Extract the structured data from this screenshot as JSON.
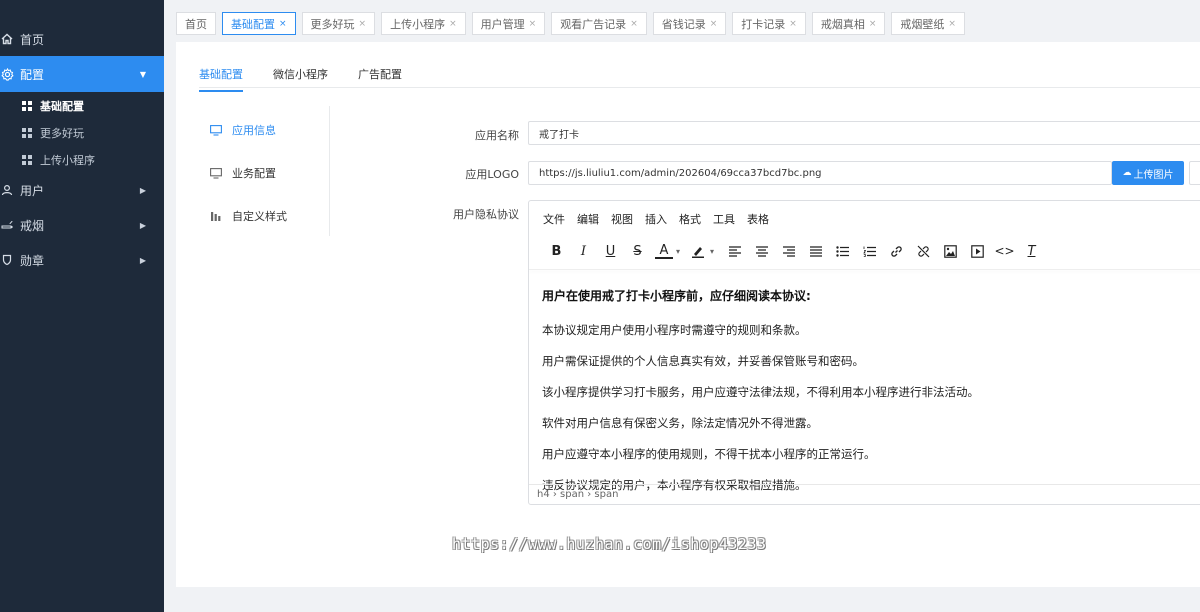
{
  "sidebar": {
    "brand": "",
    "menu": [
      {
        "label": "首页",
        "icon": "home-icon"
      },
      {
        "label": "配置",
        "icon": "gear-icon"
      },
      {
        "label": "用户",
        "icon": "user-icon"
      },
      {
        "label": "戒烟",
        "icon": "smoke-icon"
      },
      {
        "label": "勋章",
        "icon": "medal-icon"
      }
    ],
    "submenu": [
      {
        "label": "基础配置"
      },
      {
        "label": "更多好玩"
      },
      {
        "label": "上传小程序"
      }
    ]
  },
  "tabs": [
    {
      "label": "首页"
    },
    {
      "label": "基础配置"
    },
    {
      "label": "更多好玩"
    },
    {
      "label": "上传小程序"
    },
    {
      "label": "用户管理"
    },
    {
      "label": "观看广告记录"
    },
    {
      "label": "省钱记录"
    },
    {
      "label": "打卡记录"
    },
    {
      "label": "戒烟真相"
    },
    {
      "label": "戒烟壁纸"
    }
  ],
  "tab_close": "×",
  "inner_tabs": [
    {
      "label": "基础配置"
    },
    {
      "label": "微信小程序"
    },
    {
      "label": "广告配置"
    }
  ],
  "side_menu": [
    {
      "label": "应用信息",
      "icon": "monitor-icon"
    },
    {
      "label": "业务配置",
      "icon": "monitor-icon"
    },
    {
      "label": "自定义样式",
      "icon": "bar-chart-icon"
    }
  ],
  "form": {
    "app_name_label": "应用名称",
    "app_name_value": "戒了打卡",
    "app_logo_label": "应用LOGO",
    "app_logo_value": "https://js.liuliu1.com/admin/202604/69cca37bcd7bc.png",
    "upload_label": "上传图片",
    "privacy_label": "用户隐私协议"
  },
  "editor": {
    "menubar": [
      "文件",
      "编辑",
      "视图",
      "插入",
      "格式",
      "工具",
      "表格"
    ],
    "heading": "用户在使用戒了打卡小程序前，应仔细阅读本协议:",
    "paragraphs": [
      "本协议规定用户使用小程序时需遵守的规则和条款。",
      "用户需保证提供的个人信息真实有效，并妥善保管账号和密码。",
      "该小程序提供学习打卡服务，用户应遵守法律法规，不得利用本小程序进行非法活动。",
      "软件对用户信息有保密义务，除法定情况外不得泄露。",
      "用户应遵守本小程序的使用规则，不得干扰本小程序的正常运行。",
      "违反协议规定的用户，本小程序有权采取相应措施。"
    ],
    "status_path": "h4 › span › span"
  },
  "watermark": "https://www.huzhan.com/ishop43233",
  "colors": {
    "accent": "#2d8cf0",
    "sidebar_bg": "#1e2a3a"
  }
}
